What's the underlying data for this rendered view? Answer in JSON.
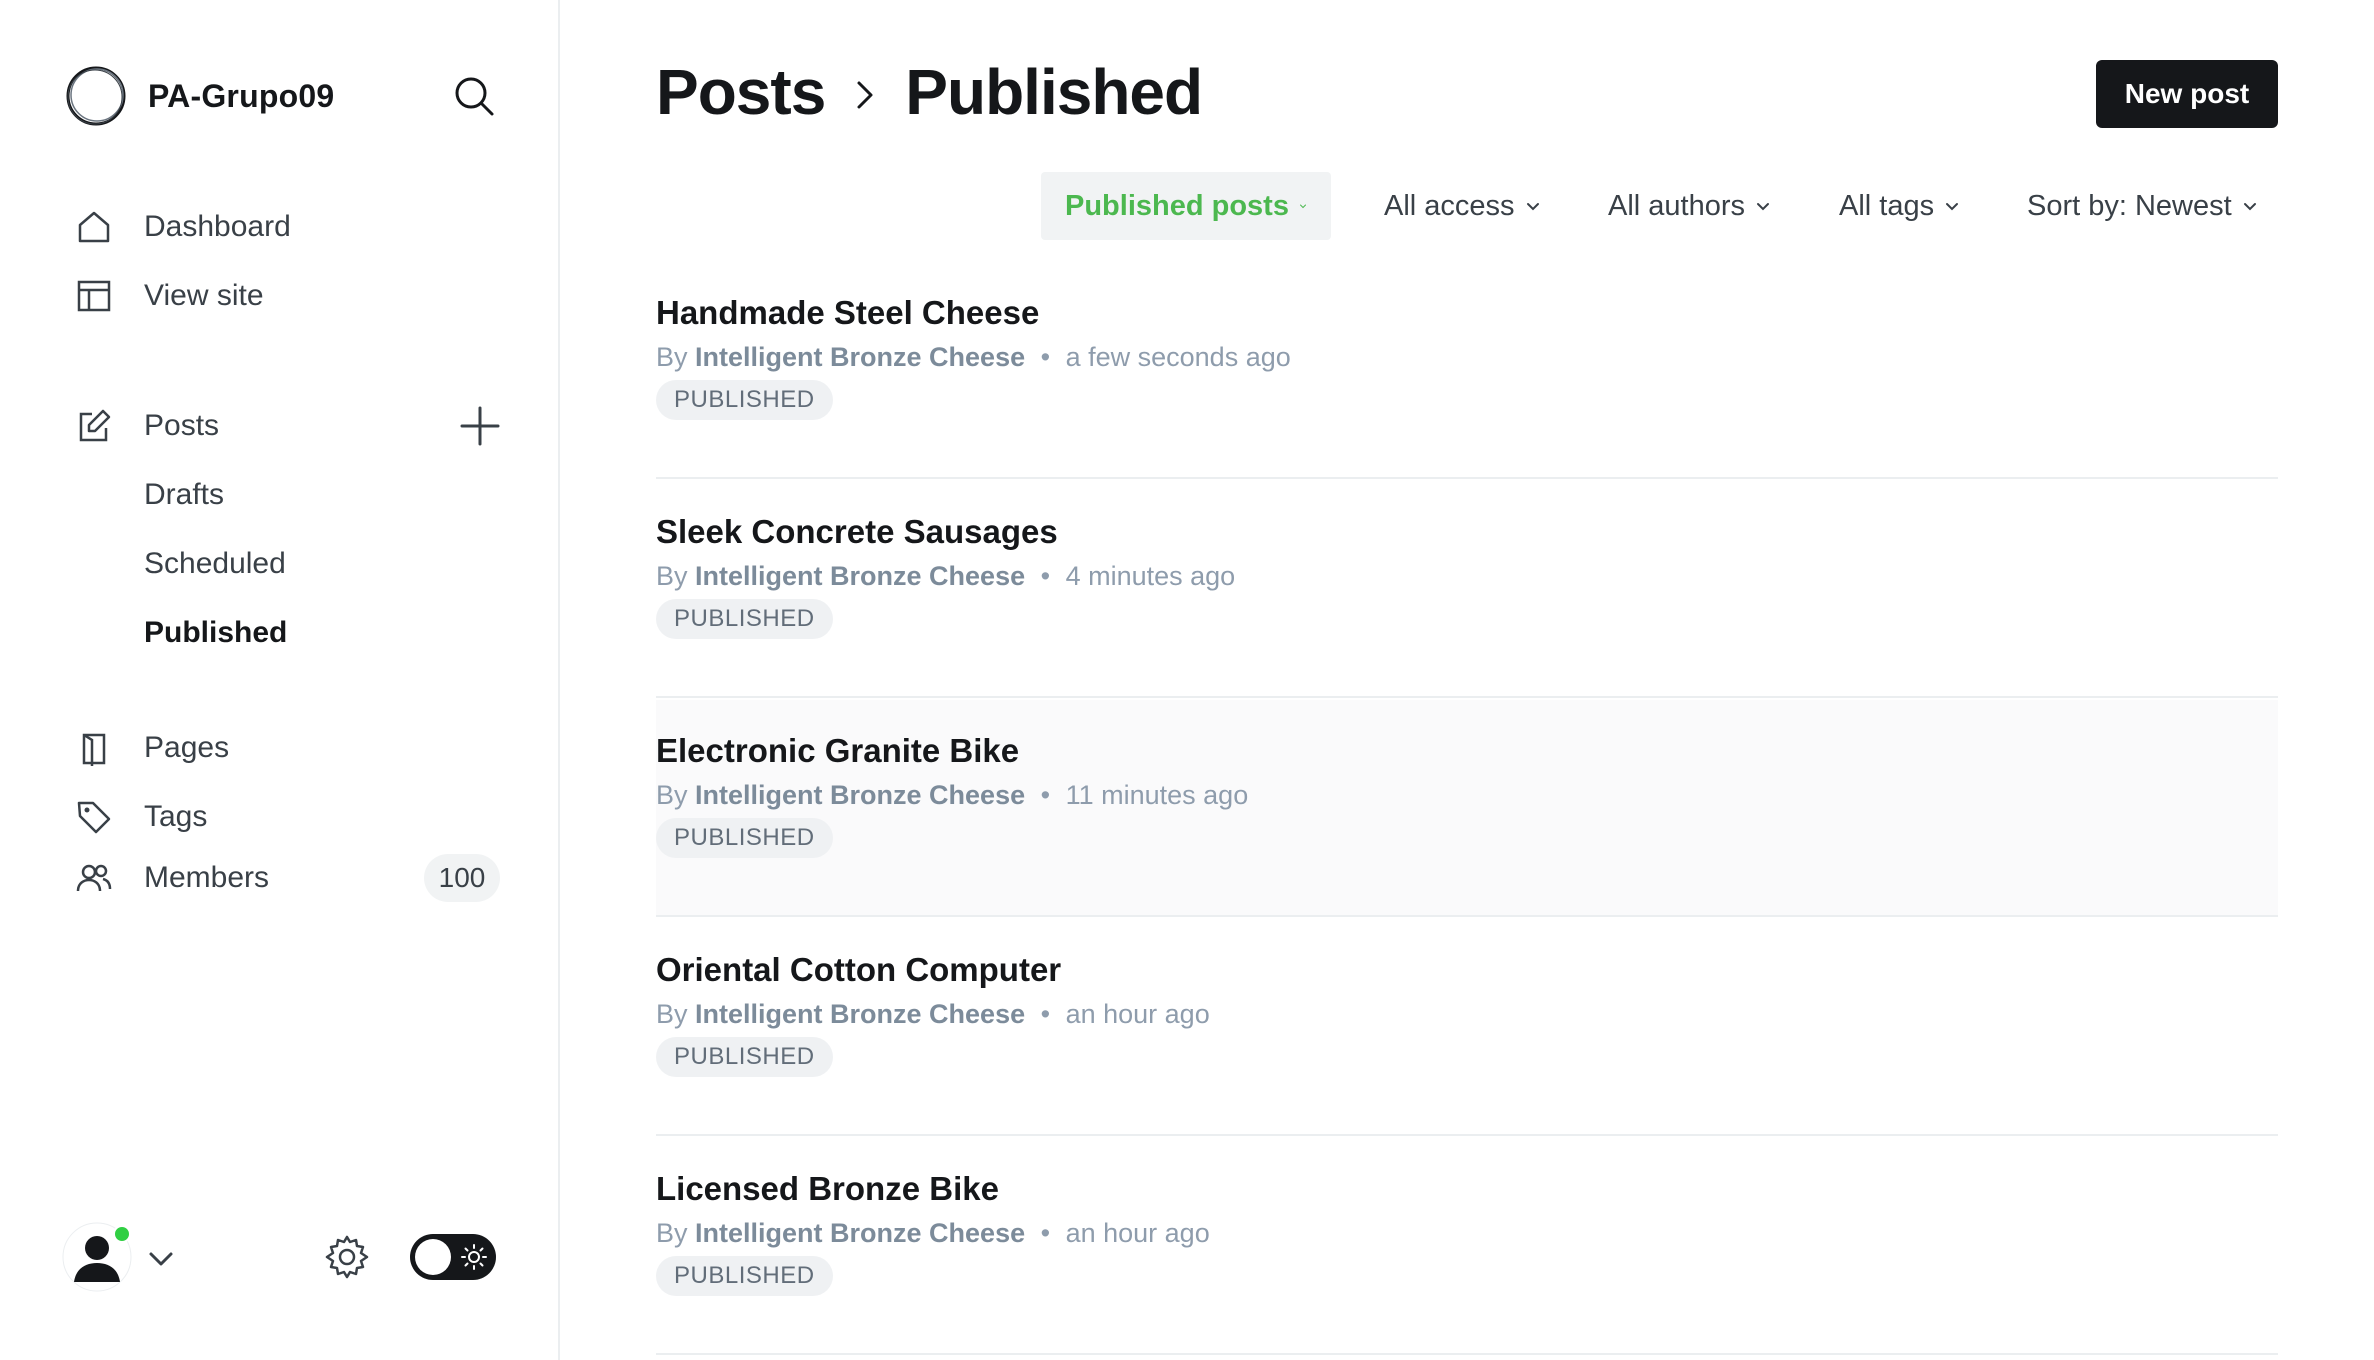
{
  "brand": {
    "name": "PA-Grupo09"
  },
  "nav": {
    "dashboard": "Dashboard",
    "view_site": "View site",
    "posts": "Posts",
    "drafts": "Drafts",
    "scheduled": "Scheduled",
    "published": "Published",
    "pages": "Pages",
    "tags": "Tags",
    "members": "Members",
    "members_count": "100"
  },
  "header": {
    "root": "Posts",
    "current": "Published",
    "new_post": "New post"
  },
  "filters": {
    "type": "Published posts",
    "access": "All access",
    "authors": "All authors",
    "tags": "All tags",
    "sort": "Sort by: Newest"
  },
  "posts": [
    {
      "title": "Handmade Steel Cheese",
      "by": "By",
      "author": "Intelligent Bronze Cheese",
      "time": "a few seconds ago",
      "status": "PUBLISHED"
    },
    {
      "title": "Sleek Concrete Sausages",
      "by": "By",
      "author": "Intelligent Bronze Cheese",
      "time": "4 minutes ago",
      "status": "PUBLISHED"
    },
    {
      "title": "Electronic Granite Bike",
      "by": "By",
      "author": "Intelligent Bronze Cheese",
      "time": "11 minutes ago",
      "status": "PUBLISHED"
    },
    {
      "title": "Oriental Cotton Computer",
      "by": "By",
      "author": "Intelligent Bronze Cheese",
      "time": "an hour ago",
      "status": "PUBLISHED"
    },
    {
      "title": "Licensed Bronze Bike",
      "by": "By",
      "author": "Intelligent Bronze Cheese",
      "time": "an hour ago",
      "status": "PUBLISHED"
    }
  ],
  "colors": {
    "accent_green": "#4cb84f",
    "online_dot": "#30cf43",
    "primary_button": "#15171a"
  },
  "icons": {
    "brand": "brand-logo-icon",
    "search": "search-icon",
    "dashboard": "home-icon",
    "view_site": "layout-icon",
    "posts": "edit-icon",
    "add": "plus-icon",
    "pages": "page-icon",
    "tags": "tag-icon",
    "members": "members-icon",
    "settings": "gear-icon",
    "theme": "sun-icon"
  }
}
